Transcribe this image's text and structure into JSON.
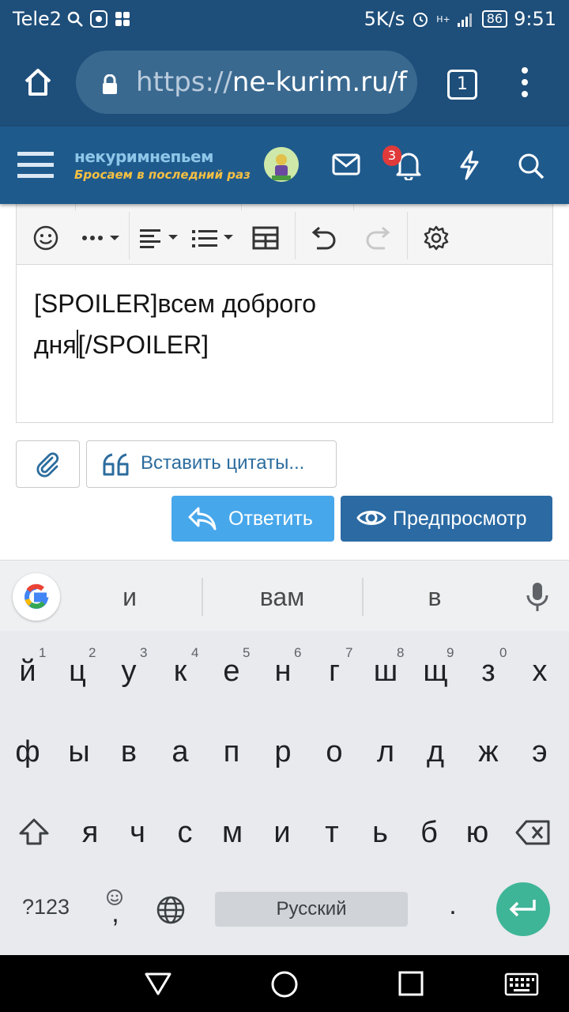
{
  "status_bar": {
    "carrier": "Tele2",
    "speed": "5K/s",
    "network": "H+",
    "battery": "86",
    "time": "9:51"
  },
  "browser": {
    "url_scheme": "https://",
    "url_host": "ne-kurim.ru/f",
    "tab_count": "1"
  },
  "site_header": {
    "logo_title": "некуримнепьем",
    "logo_subtitle": "Бросаем в последний раз",
    "notifications_count": "3"
  },
  "editor": {
    "line1": "[SPOILER]всем доброго",
    "line2_before_caret": "дня",
    "line2_after_caret": "[/SPOILER]"
  },
  "actions": {
    "insert_quotes": "Вставить цитаты...",
    "reply": "Ответить",
    "preview": "Предпросмотр"
  },
  "keyboard": {
    "suggestions": [
      "и",
      "вам",
      "в"
    ],
    "row1": [
      "й",
      "ц",
      "у",
      "к",
      "е",
      "н",
      "г",
      "ш",
      "щ",
      "з",
      "х"
    ],
    "row1_hints": [
      "1",
      "2",
      "3",
      "4",
      "5",
      "6",
      "7",
      "8",
      "9",
      "0"
    ],
    "row2": [
      "ф",
      "ы",
      "в",
      "а",
      "п",
      "р",
      "о",
      "л",
      "д",
      "ж",
      "э"
    ],
    "row3": [
      "я",
      "ч",
      "с",
      "м",
      "и",
      "т",
      "ь",
      "б",
      "ю"
    ],
    "symbols_key": "?123",
    "comma_key": ",",
    "space_label": "Русский",
    "period_key": "."
  },
  "colors": {
    "brand_dark": "#1e4e7a",
    "header": "#1f5a8d",
    "reply_button": "#47a7eb",
    "preview_button": "#2b6aa3",
    "enter_key": "#3fb598"
  }
}
